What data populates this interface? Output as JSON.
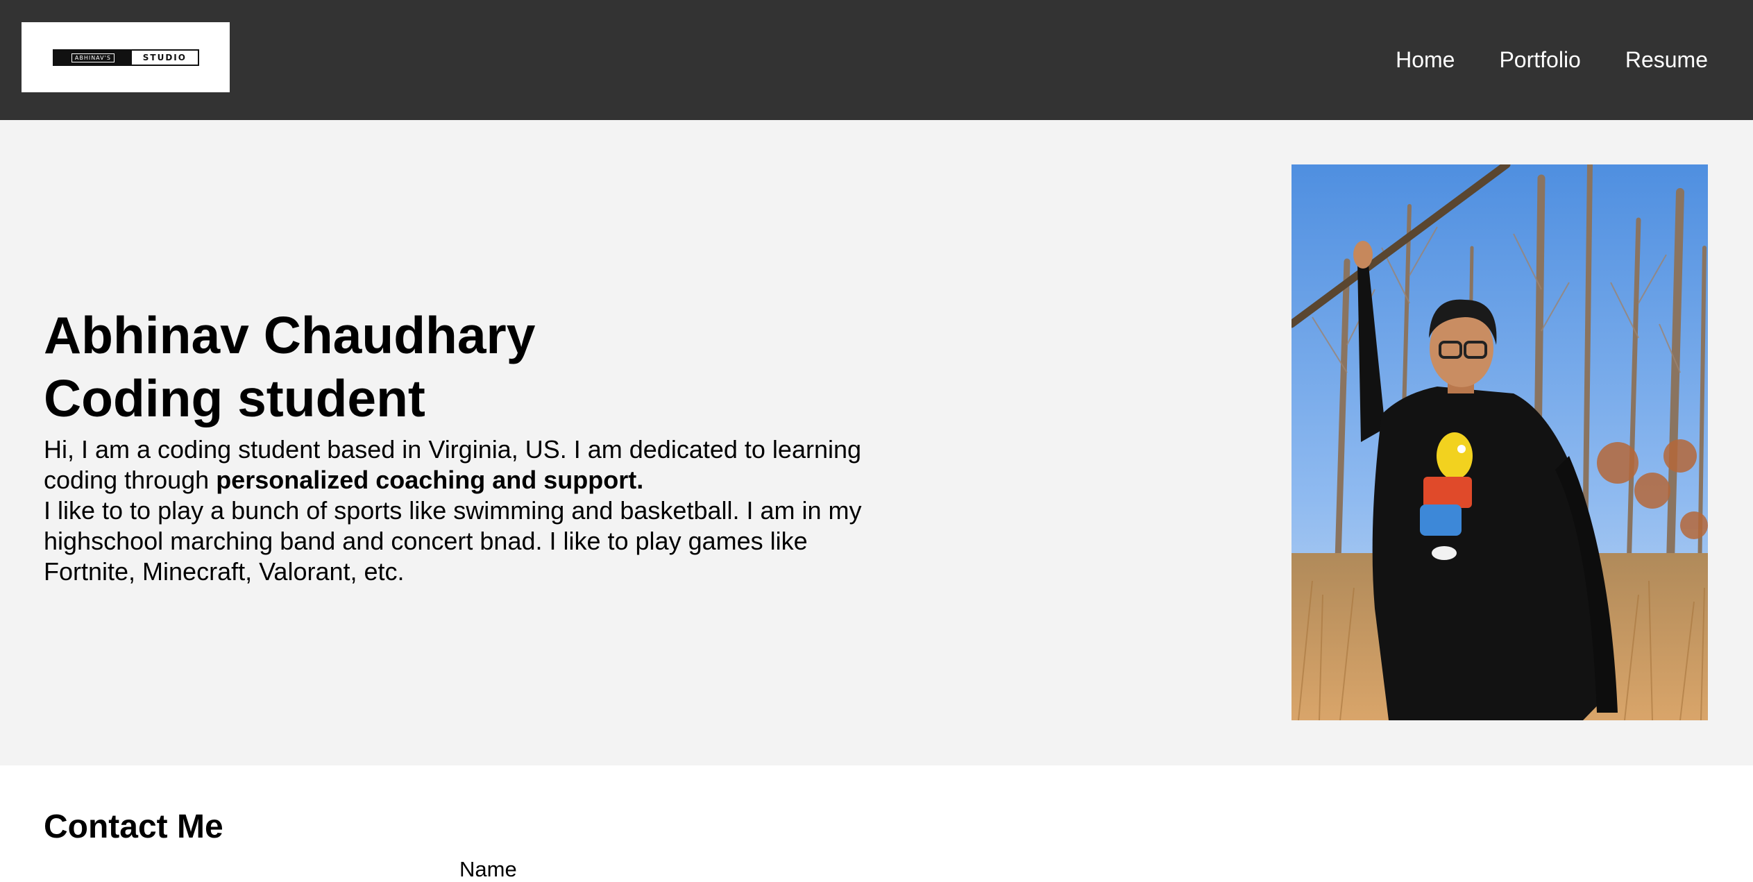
{
  "header": {
    "logo": {
      "left_text": "ABHINAV'S",
      "right_text": "STUDIO"
    },
    "nav": [
      {
        "label": "Home"
      },
      {
        "label": "Portfolio"
      },
      {
        "label": "Resume"
      }
    ]
  },
  "hero": {
    "name": "Abhinav Chaudhary",
    "role": "Coding student",
    "bio_part1": "Hi, I am a coding student based in Virginia, US. I am dedicated to learning coding through ",
    "bio_bold": "personalized coaching and support.",
    "bio_part2": "I like to to play a bunch of sports like swimming and basketball. I am in my highschool marching band and concert bnad. I like to play games like Fortnite, Minecraft, Valorant, etc."
  },
  "contact": {
    "title": "Contact Me",
    "name_label": "Name"
  },
  "colors": {
    "header_bg": "#333333",
    "hero_bg": "#f3f3f3",
    "nav_text": "#ffffff"
  }
}
